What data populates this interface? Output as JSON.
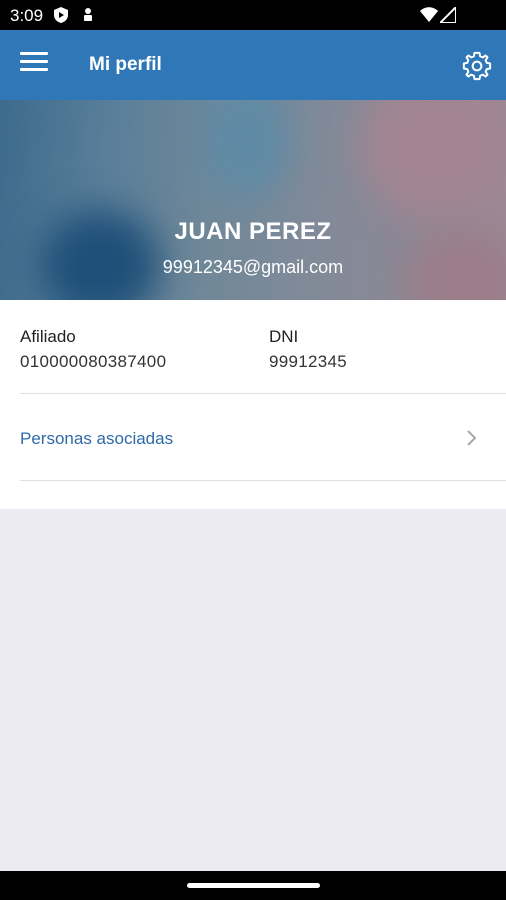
{
  "status_bar": {
    "time": "3:09",
    "icons": [
      "play-protect-icon",
      "usb-debug-icon",
      "wifi-icon",
      "signal-icon"
    ]
  },
  "app_bar": {
    "title": "Mi perfil",
    "menu_icon": "hamburger-menu-icon",
    "settings_icon": "gear-icon",
    "background_color": "#2f77b6"
  },
  "profile": {
    "name": "JUAN PEREZ",
    "email": "99912345@gmail.com"
  },
  "details": {
    "affiliate_label": "Afiliado",
    "affiliate_value": "010000080387400",
    "dni_label": "DNI",
    "dni_value": "99912345"
  },
  "associated": {
    "label": "Personas asociadas",
    "chevron_icon": "chevron-right-icon",
    "link_color": "#2f6aa8"
  }
}
